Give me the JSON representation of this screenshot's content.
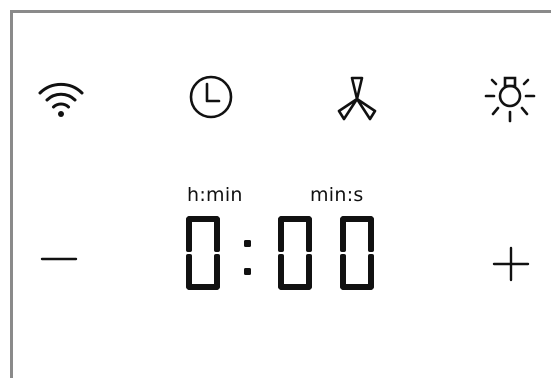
{
  "panel": {
    "icons": [
      {
        "name": "wifi-icon"
      },
      {
        "name": "clock-icon"
      },
      {
        "name": "fan-icon"
      },
      {
        "name": "light-icon"
      }
    ]
  },
  "display": {
    "unit_left": "h:min",
    "unit_right": "min:s",
    "time": "0:00"
  },
  "controls": {
    "decrease_icon": "minus-icon",
    "increase_icon": "plus-icon"
  },
  "colors": {
    "frame": "#8a8a8a",
    "ink": "#111111",
    "background": "#ffffff"
  }
}
